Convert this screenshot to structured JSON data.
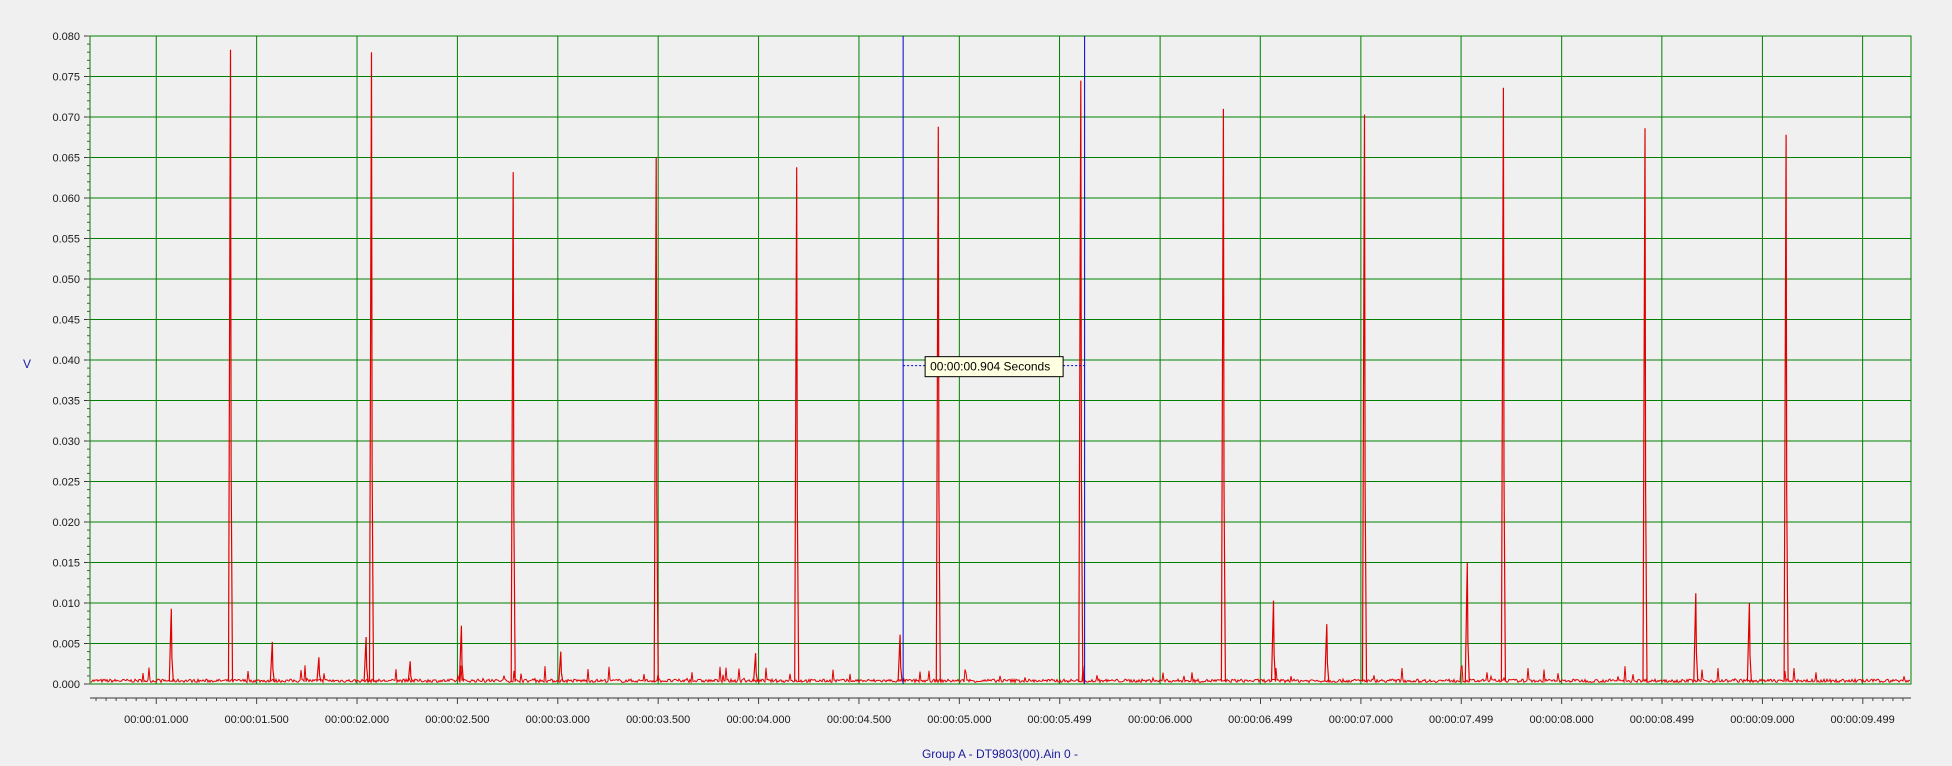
{
  "chart_data": {
    "type": "line",
    "xlabel": "Group A - DT9803(00).Ain 0 -",
    "ylabel": "V",
    "x_unit": "seconds",
    "xlim": [
      0.67,
      9.74
    ],
    "ylim": [
      0,
      0.08
    ],
    "y_ticks": [
      0.0,
      0.005,
      0.01,
      0.015,
      0.02,
      0.025,
      0.03,
      0.035,
      0.04,
      0.045,
      0.05,
      0.055,
      0.06,
      0.065,
      0.07,
      0.075,
      0.08
    ],
    "y_tick_labels": [
      "0.000",
      "0.005",
      "0.010",
      "0.015",
      "0.020",
      "0.025",
      "0.030",
      "0.035",
      "0.040",
      "0.045",
      "0.050",
      "0.055",
      "0.060",
      "0.065",
      "0.070",
      "0.075",
      "0.080"
    ],
    "x_ticks": [
      1.0,
      1.5,
      2.0,
      2.5,
      3.0,
      3.5,
      4.0,
      4.5,
      5.0,
      5.499,
      6.0,
      6.499,
      7.0,
      7.499,
      8.0,
      8.499,
      9.0,
      9.499
    ],
    "x_tick_labels": [
      "00:00:01.000",
      "00:00:01.500",
      "00:00:02.000",
      "00:00:02.500",
      "00:00:03.000",
      "00:00:03.500",
      "00:00:04.000",
      "00:00:04.500",
      "00:00:05.000",
      "00:00:05.499",
      "00:00:06.000",
      "00:00:06.499",
      "00:00:07.000",
      "00:00:07.499",
      "00:00:08.000",
      "00:00:08.499",
      "00:00:09.000",
      "00:00:09.499"
    ],
    "x_gridlines": [
      1.0,
      1.5,
      2.0,
      2.5,
      3.0,
      3.5,
      4.0,
      4.5,
      5.0,
      5.499,
      6.0,
      6.499,
      7.0,
      7.499,
      8.0,
      8.499,
      9.0,
      9.499
    ],
    "grid": true,
    "colors": {
      "series": "#e00000",
      "grid": "#008000",
      "cursor": "#0000cc",
      "background": "#f0f0f0",
      "tooltip_bg": "#ffffe1"
    },
    "series": [
      {
        "peaks": [
          {
            "x": 1.075,
            "y": 0.0093
          },
          {
            "x": 1.37,
            "y": 0.0783
          },
          {
            "x": 1.578,
            "y": 0.0052
          },
          {
            "x": 1.81,
            "y": 0.0033
          },
          {
            "x": 2.045,
            "y": 0.0058
          },
          {
            "x": 2.072,
            "y": 0.078
          },
          {
            "x": 2.265,
            "y": 0.0028
          },
          {
            "x": 2.52,
            "y": 0.0072
          },
          {
            "x": 2.778,
            "y": 0.0632
          },
          {
            "x": 3.015,
            "y": 0.004
          },
          {
            "x": 3.49,
            "y": 0.065
          },
          {
            "x": 3.985,
            "y": 0.0038
          },
          {
            "x": 4.19,
            "y": 0.0638
          },
          {
            "x": 4.705,
            "y": 0.0061
          },
          {
            "x": 4.895,
            "y": 0.0688
          },
          {
            "x": 5.605,
            "y": 0.0745
          },
          {
            "x": 6.315,
            "y": 0.071
          },
          {
            "x": 6.565,
            "y": 0.0103
          },
          {
            "x": 6.83,
            "y": 0.0074
          },
          {
            "x": 7.018,
            "y": 0.0703
          },
          {
            "x": 7.53,
            "y": 0.015
          },
          {
            "x": 7.71,
            "y": 0.0736
          },
          {
            "x": 8.415,
            "y": 0.0686
          },
          {
            "x": 8.668,
            "y": 0.0112
          },
          {
            "x": 8.935,
            "y": 0.01
          },
          {
            "x": 9.118,
            "y": 0.0678
          }
        ]
      }
    ],
    "cursors": {
      "x1": 4.72,
      "x2": 5.624,
      "delta_label": "00:00:00.904 Seconds",
      "label_y": 0.0393
    }
  }
}
